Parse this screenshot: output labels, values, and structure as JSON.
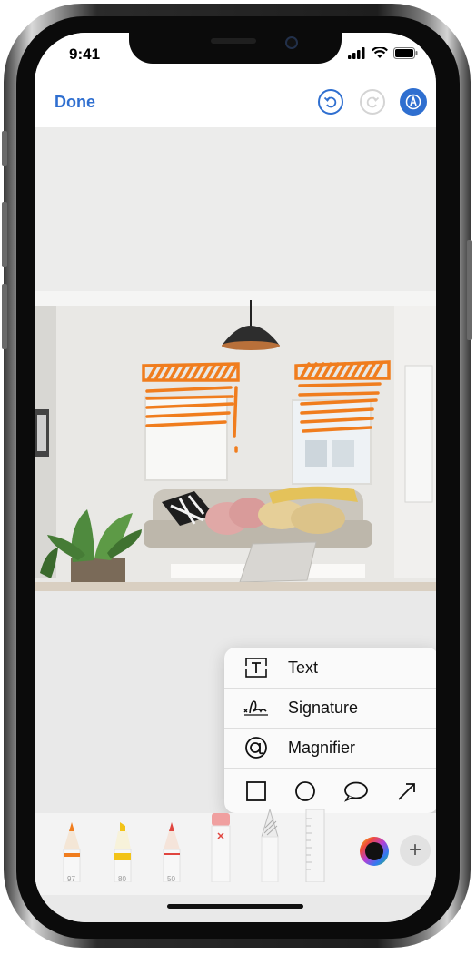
{
  "status_bar": {
    "time": "9:41"
  },
  "nav": {
    "done_label": "Done"
  },
  "popup_menu": {
    "items": [
      {
        "label": "Text",
        "icon": "text-box-icon"
      },
      {
        "label": "Signature",
        "icon": "signature-icon"
      },
      {
        "label": "Magnifier",
        "icon": "magnifier-icon"
      }
    ],
    "shapes": [
      "square-icon",
      "circle-icon",
      "speech-bubble-icon",
      "arrow-icon"
    ]
  },
  "toolbar": {
    "tools": [
      {
        "name": "pen",
        "width_label": "97",
        "color": "#f07d1e"
      },
      {
        "name": "marker",
        "width_label": "80",
        "color": "#f2c318"
      },
      {
        "name": "pencil",
        "width_label": "50",
        "color": "#e0453f"
      },
      {
        "name": "eraser",
        "width_label": "",
        "color": "#f0a0a0"
      },
      {
        "name": "lasso",
        "width_label": "",
        "color": "#9a9a9a"
      },
      {
        "name": "ruler",
        "width_label": "",
        "color": "#c8c8c8"
      }
    ],
    "add_label": "+"
  },
  "colors": {
    "accent": "#2f6fd0",
    "markup_orange": "#f07d1e"
  }
}
